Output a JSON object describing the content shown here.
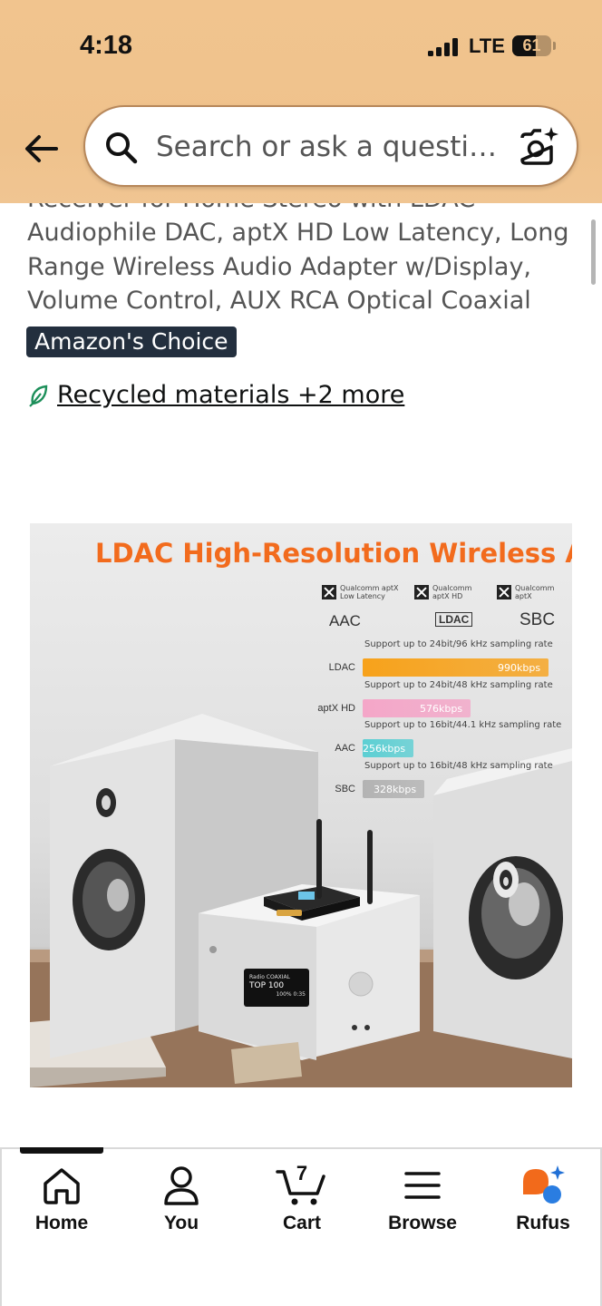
{
  "status_bar": {
    "time": "4:18",
    "network": "LTE",
    "battery": "61",
    "battery_level": 0.61
  },
  "header": {
    "back_icon": "arrow-left-icon",
    "search_placeholder": "Search or ask a questi…",
    "search_icon": "search-icon",
    "camera_icon": "camera-sparkle-icon"
  },
  "product": {
    "title_cut": "Receiver for Home Stereo with LDAC",
    "title_lines": [
      "Audiophile DAC, aptX HD Low Latency, Long",
      "Range Wireless Audio Adapter w/Display,",
      "Volume Control, AUX RCA Optical Coaxial"
    ],
    "badge": "Amazon's Choice",
    "sustainability_link": "Recycled materials +2 more",
    "image": {
      "headline": "LDAC High-Resolution Wireless Audio",
      "qualcomm_logos": [
        "Qualcomm aptX\nLow Latency",
        "Qualcomm\naptX HD",
        "Qualcomm\naptX"
      ],
      "codec_logos": {
        "aac": "AAC",
        "ldac": "LDAC",
        "sbc": "SBC"
      },
      "codecs": [
        {
          "name": "LDAC",
          "caption": "Support up to 24bit/96 kHz sampling rate",
          "value": "990kbps",
          "kbps": 990,
          "color": "#f7a21b"
        },
        {
          "name": "aptX HD",
          "caption": "Support up to 24bit/48 kHz sampling rate",
          "value": "576kbps",
          "kbps": 576,
          "color": "#f4a6c8"
        },
        {
          "name": "AAC",
          "caption": "Support up to 16bit/44.1 kHz sampling rate",
          "value": "256kbps",
          "kbps": 256,
          "color": "#5ccfd3"
        },
        {
          "name": "SBC",
          "caption": "Support up to 16bit/48 kHz sampling rate",
          "value": "328kbps",
          "kbps": 328,
          "color": "#b3b3b3"
        }
      ],
      "device_display": {
        "line1": "Radio COAXIAL",
        "line2": "TOP 100",
        "line3": "100% 0:35"
      }
    }
  },
  "bottom_nav": {
    "items": [
      {
        "label": "Home",
        "icon": "home-icon"
      },
      {
        "label": "You",
        "icon": "person-icon"
      },
      {
        "label": "Cart",
        "icon": "cart-icon"
      },
      {
        "label": "Browse",
        "icon": "menu-icon"
      },
      {
        "label": "Rufus",
        "icon": "rufus-icon"
      }
    ],
    "cart_count": "7",
    "active_index": 0
  }
}
